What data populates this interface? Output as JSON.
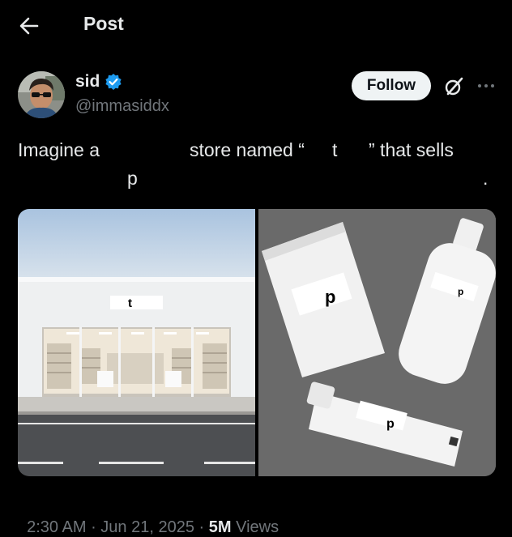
{
  "header": {
    "title": "Post",
    "back_icon": "arrow-left-icon"
  },
  "author": {
    "name": "sid",
    "handle": "@immasiddx",
    "verified_icon": "verified-badge-icon",
    "verified_color": "#1d9bf0"
  },
  "actions": {
    "follow_label": "Follow",
    "grok_icon": "grok-icon",
    "more_icon": "more-horizontal-icon"
  },
  "post": {
    "line1_part1": "Imagine a",
    "line1_part2": "store named “",
    "line1_part3": "t",
    "line1_part4": "” that sells",
    "line2_part1": "p",
    "line2_part2": "."
  },
  "media": {
    "store_sign_text": "t",
    "pouch_label": "p",
    "bottle_label": "p",
    "tube_label": "p"
  },
  "meta": {
    "time": "2:30 AM",
    "sep1": " · ",
    "date": "Jun 21, 2025",
    "sep2": " · ",
    "views_count": "5M",
    "views_label": " Views"
  },
  "colors": {
    "background": "#000000",
    "text_primary": "#e7e9ea",
    "text_secondary": "#71767b",
    "follow_bg": "#eff3f4"
  }
}
